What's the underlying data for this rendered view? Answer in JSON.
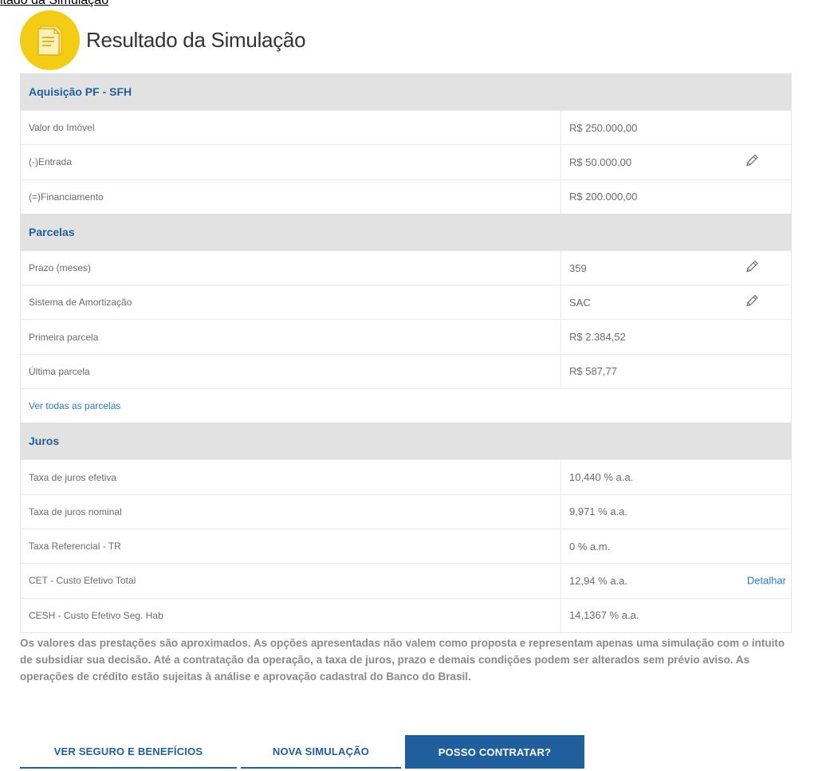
{
  "top_partial_text": "ltado da Simulação",
  "header": {
    "title": "Resultado da Simulação"
  },
  "sections": {
    "aquisicao": {
      "title": "Aquisição PF - SFH",
      "rows": [
        {
          "label": "Valor do Imóvel",
          "value": "R$ 250.000,00"
        },
        {
          "label": "(-)Entrada",
          "value": "R$ 50.000,00"
        },
        {
          "label": "(=)Financiamento",
          "value": "R$ 200.000,00"
        }
      ]
    },
    "parcelas": {
      "title": "Parcelas",
      "rows": [
        {
          "label": "Prazo (meses)",
          "value": "359"
        },
        {
          "label": "Sistema de Amortização",
          "value": "SAC"
        },
        {
          "label": "Primeira parcela",
          "value": "R$ 2.384,52"
        },
        {
          "label": "Última parcela",
          "value": "R$ 587,77"
        }
      ],
      "link": "Ver todas as parcelas"
    },
    "juros": {
      "title": "Juros",
      "rows": [
        {
          "label": "Taxa de juros efetiva",
          "value": "10,440 % a.a."
        },
        {
          "label": "Taxa de juros nominal",
          "value": "9,971 % a.a."
        },
        {
          "label": "Taxa Referencial - TR",
          "value": "0 % a.m."
        },
        {
          "label": "CET - Custo Efetivo Total",
          "value": "12,94 % a.a.",
          "action": "Detalhar"
        },
        {
          "label": "CESH - Custo Efetivo Seg. Hab",
          "value": "14,1367 % a.a."
        }
      ]
    }
  },
  "disclaimer": "Os valores das prestações são aproximados. As opções apresentadas não valem como proposta e representam apenas uma simulação com o intuito de subsidiar sua decisão. Até a contratação da operação, a taxa de juros, prazo e demais condições podem ser alterados sem prévio aviso. As operações de crédito estão sujeitas à análise e aprovação cadastral do Banco do Brasil.",
  "buttons": {
    "seguro": "VER SEGURO E BENEFÍCIOS",
    "nova": "NOVA SIMULAÇÃO",
    "contratar": "POSSO CONTRATAR?"
  },
  "colors": {
    "accent": "#1f5f9e",
    "icon_bg": "#f5cc14",
    "section_bg": "#e2e2e2"
  },
  "icons": {
    "header": "document-icon",
    "edit": "pencil-icon"
  }
}
